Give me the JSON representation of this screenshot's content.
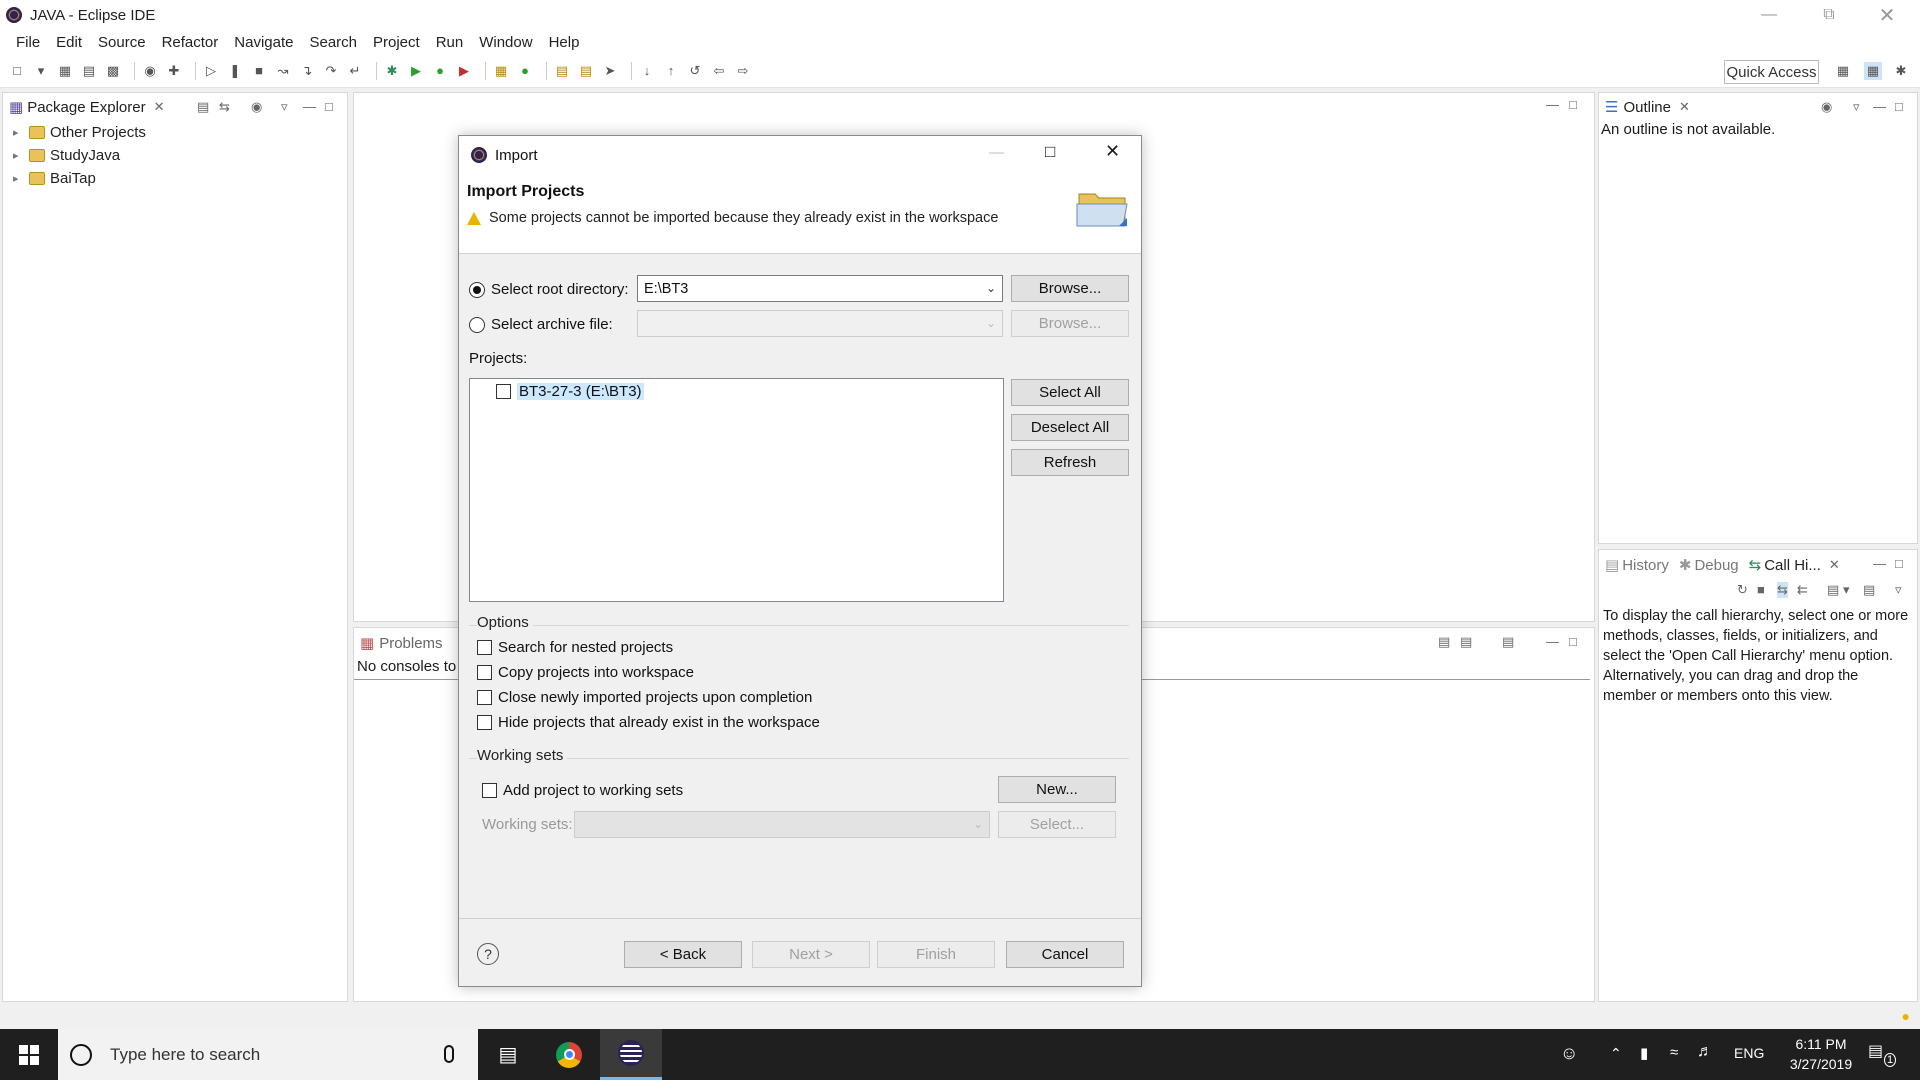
{
  "window": {
    "title": "JAVA - Eclipse IDE"
  },
  "menubar": [
    "File",
    "Edit",
    "Source",
    "Refactor",
    "Navigate",
    "Search",
    "Project",
    "Run",
    "Window",
    "Help"
  ],
  "toolbar": {
    "quick_access": "Quick Access"
  },
  "package_explorer": {
    "title": "Package Explorer",
    "items": [
      "Other Projects",
      "StudyJava",
      "BaiTap"
    ]
  },
  "outline": {
    "title": "Outline",
    "message": "An outline is not available."
  },
  "bottom_right": {
    "tabs": [
      "History",
      "Debug",
      "Call Hi..."
    ],
    "message": "To display the call hierarchy, select one or more methods, classes, fields, or initializers, and select the 'Open Call Hierarchy' menu option. Alternatively, you can drag and drop the member or members onto this view."
  },
  "console": {
    "tab": "Problems",
    "message": "No consoles to"
  },
  "dialog": {
    "title": "Import",
    "heading": "Import Projects",
    "warning": "Some projects cannot be imported because they already exist in the workspace",
    "root_dir_label": "Select root directory:",
    "root_dir_value": "E:\\BT3",
    "archive_label": "Select archive file:",
    "browse_label": "Browse...",
    "projects_label": "Projects:",
    "projects": [
      "BT3-27-3 (E:\\BT3)"
    ],
    "select_all": "Select All",
    "deselect_all": "Deselect All",
    "refresh": "Refresh",
    "options_label": "Options",
    "options": [
      "Search for nested projects",
      "Copy projects into workspace",
      "Close newly imported projects upon completion",
      "Hide projects that already exist in the workspace"
    ],
    "working_sets_label": "Working sets",
    "add_to_ws": "Add project to working sets",
    "new_btn": "New...",
    "ws_field_label": "Working sets:",
    "select_btn": "Select...",
    "help": "?",
    "back": "< Back",
    "next": "Next >",
    "finish": "Finish",
    "cancel": "Cancel"
  },
  "taskbar": {
    "search_placeholder": "Type here to search",
    "lang": "ENG",
    "time": "6:11 PM",
    "date": "3/27/2019",
    "notifications": "1"
  }
}
